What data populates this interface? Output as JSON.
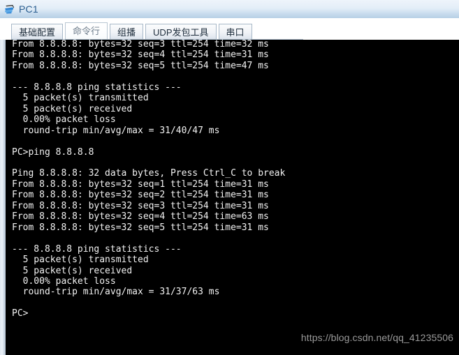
{
  "window": {
    "title": "PC1",
    "icon": "pc-device-icon"
  },
  "tabs": [
    {
      "id": "basic-config",
      "label": "基础配置",
      "selected": false
    },
    {
      "id": "command-line",
      "label": "命令行",
      "selected": true
    },
    {
      "id": "multicast",
      "label": "组播",
      "selected": false
    },
    {
      "id": "udp-packet-tool",
      "label": "UDP发包工具",
      "selected": false
    },
    {
      "id": "serial-port",
      "label": "串口",
      "selected": false
    }
  ],
  "terminal": {
    "foreground_color": "#f2f2f2",
    "background_color": "#000000",
    "content": "From 8.8.8.8: bytes=32 seq=3 ttl=254 time=32 ms\nFrom 8.8.8.8: bytes=32 seq=4 ttl=254 time=31 ms\nFrom 8.8.8.8: bytes=32 seq=5 ttl=254 time=47 ms\n\n--- 8.8.8.8 ping statistics ---\n  5 packet(s) transmitted\n  5 packet(s) received\n  0.00% packet loss\n  round-trip min/avg/max = 31/40/47 ms\n\nPC>ping 8.8.8.8\n\nPing 8.8.8.8: 32 data bytes, Press Ctrl_C to break\nFrom 8.8.8.8: bytes=32 seq=1 ttl=254 time=31 ms\nFrom 8.8.8.8: bytes=32 seq=2 ttl=254 time=31 ms\nFrom 8.8.8.8: bytes=32 seq=3 ttl=254 time=31 ms\nFrom 8.8.8.8: bytes=32 seq=4 ttl=254 time=63 ms\nFrom 8.8.8.8: bytes=32 seq=5 ttl=254 time=31 ms\n\n--- 8.8.8.8 ping statistics ---\n  5 packet(s) transmitted\n  5 packet(s) received\n  0.00% packet loss\n  round-trip min/avg/max = 31/37/63 ms\n\nPC>"
  },
  "watermark": {
    "text": "https://blog.csdn.net/qq_41235506",
    "color": "#9a9a9a"
  }
}
